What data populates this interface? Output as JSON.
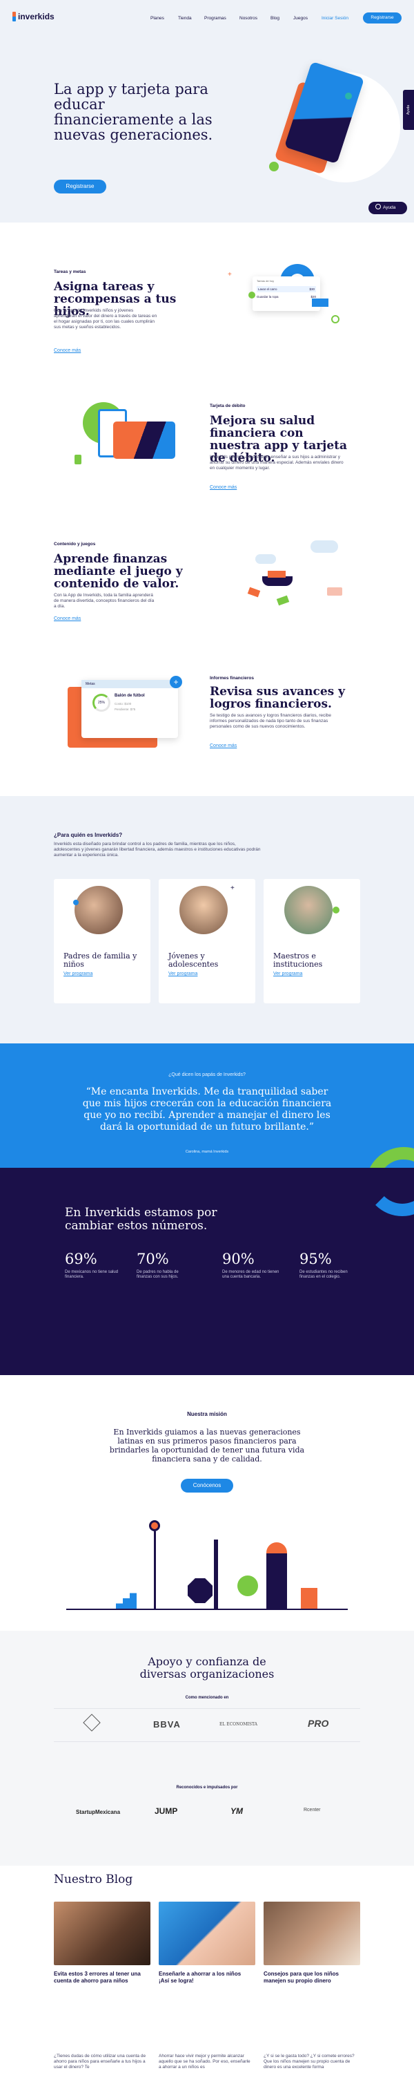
{
  "nav": {
    "logo": "inverkids",
    "items": [
      "Planes",
      "Tienda",
      "Programas",
      "Nosotros",
      "Blog",
      "Juegos"
    ],
    "login": "Iniciar Sesión",
    "register": "Registrarse"
  },
  "hero": {
    "title": "La app y tarjeta para educar financieramente a las nuevas generaciones.",
    "cta": "Registrarse",
    "help_tab": "Ayuda",
    "help_button": "Ayuda"
  },
  "features": [
    {
      "eyebrow": "Tareas y metas",
      "title": "Asigna tareas y recompensas a tus hijos.",
      "body": "Con la App de Inverkids niños y jóvenes aprenderán el valor del dinero a través de tareas en el hogar asignadas por ti, con las cuales cumplirán sus metas y sueños establecidos.",
      "link": "Conoce más",
      "mock_title": "Tareas de hoy",
      "mock_rows": [
        {
          "label": "Lavar el carro",
          "amount": "$30"
        },
        {
          "label": "Guardar la ropa",
          "amount": "$20"
        }
      ]
    },
    {
      "eyebrow": "Tarjeta de débito",
      "title": "Mejora su salud financiera con nuestra app y tarjeta de débito.",
      "body": "Inverkids permite a los padres enseñar a sus hijos a administrar y ahorrar su dinero de una manera especial. Además envíales dinero en cualquier momento y lugar.",
      "link": "Conoce más"
    },
    {
      "eyebrow": "Contenido y juegos",
      "title": "Aprende finanzas mediante el juego y contenido de valor.",
      "body": "Con la App de Inverkids, toda la familia aprenderá de manera divertida, conceptos financieros del día a día.",
      "link": "Conoce más"
    },
    {
      "eyebrow": "Informes financieros",
      "title": "Revisa sus avances y logros financieros.",
      "body": "Se testigo de sus avances y logros financieros diarios, recibe informes personalizados de nada tipo tanto de sus finanzas personales como de sus nuevos conocimientos.",
      "link": "Conoce más",
      "mock_header": "Metas",
      "mock_goal": "Balón de fútbol",
      "mock_percent": "25%",
      "mock_cost": "Costo: $100",
      "mock_pending": "Pendiente: $75"
    }
  ],
  "audience": {
    "title": "¿Para quién es Inverkids?",
    "body": "Inverkids esta diseñado para brindar control a los padres de familia, mientras que los niños, adolescentes y jóvenes ganarán libertad financiera, además maestros e instituciones educativas podrán aumentar a la experiencia única.",
    "cards": [
      {
        "title": "Padres de familia y niños",
        "link": "Ver programa"
      },
      {
        "title": "Jóvenes y adolescentes",
        "link": "Ver programa"
      },
      {
        "title": "Maestros e instituciones",
        "link": "Ver programa"
      }
    ]
  },
  "testimonial": {
    "eyebrow": "¿Qué dicen los papás de Inverkids?",
    "quote": "“Me encanta Inverkids. Me da tranquilidad saber que mis hijos crecerán con la educación financiera que yo no recibí. Aprender a manejar el dinero les dará la oportunidad de un futuro brillante.”",
    "author": "Carolina, mamá Inverkids"
  },
  "stats": {
    "title": "En Inverkids estamos por cambiar estos números.",
    "items": [
      {
        "value": "69%",
        "label": "De mexicanos no tiene salud financiera."
      },
      {
        "value": "70%",
        "label": "De padres no habla de finanzas con sus hijos."
      },
      {
        "value": "90%",
        "label": "De menores de edad no tienen una cuenta bancaria."
      },
      {
        "value": "95%",
        "label": "De estudiantes no reciben finanzas en el colegio."
      }
    ]
  },
  "mission": {
    "eyebrow": "Nuestra misión",
    "text": "En Inverkids guiamos a las nuevas generaciones latinas en sus primeros pasos financieros para brindarles la oportunidad de tener una futura vida financiera sana y de calidad.",
    "cta": "Conócenos"
  },
  "trust": {
    "title": "Apoyo y confianza de diversas organizaciones",
    "mentioned_label": "Como mencionado en",
    "media": [
      "BBVA",
      "EL ECONOMISTA",
      "PRO"
    ],
    "recognized_label": "Reconocidos e impulsados por",
    "partners": [
      "StartupMexicana",
      "JUMP",
      "YM",
      "Rcenter"
    ]
  },
  "blog": {
    "title": "Nuestro Blog",
    "posts": [
      {
        "title": "Evita estos 3 errores al tener una cuenta de ahorro para niños",
        "excerpt": "¿Tienes dudas de cómo utilizar una cuenta de ahorro para niños para enseñarle a tus hijos a usar el dinero? Te"
      },
      {
        "title": "Enseñarle a ahorrar a los niños ¡Así se logra!",
        "excerpt": "Ahorrar hace vivir mejor y permite alcanzar aquello que se ha soñado. Por eso, enseñarle a ahorrar a un niños es"
      },
      {
        "title": "Consejos para que los niños manejen su propio dinero",
        "excerpt": "¿Y si se le gasta todo? ¿Y si comete errores? Que los niños manejen su propio cuenta de dinero es una excelente forma"
      }
    ]
  },
  "colors": {
    "navy": "#1b1049",
    "blue": "#1e88e5",
    "orange": "#f26b3a",
    "green": "#7ac943"
  }
}
